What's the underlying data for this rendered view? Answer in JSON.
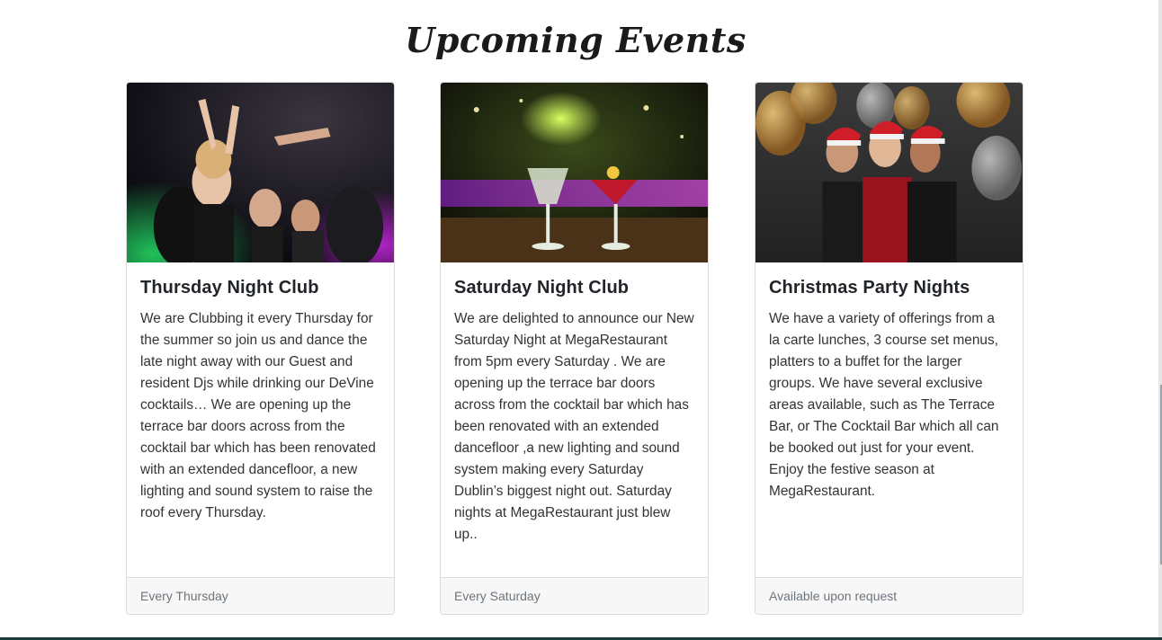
{
  "section": {
    "title": "Upcoming Events"
  },
  "events": [
    {
      "title": "Thursday Night Club",
      "description": "We are Clubbing it every Thursday for the summer so join us and dance the late night away with our Guest and resident Djs while drinking our DeVine cocktails… We are opening up the terrace bar doors across from the cocktail bar which has been renovated with an extended dancefloor, a new lighting and sound system to raise the roof every Thursday.",
      "footer": "Every Thursday",
      "image": "club-dancing-photo"
    },
    {
      "title": "Saturday Night Club",
      "description": "We are delighted to announce our New Saturday Night at MegaRestaurant from 5pm every Saturday . We are opening up the terrace bar doors across from the cocktail bar which has been renovated with an extended dancefloor ,a new lighting and sound system making every Saturday Dublin’s biggest night out. Saturday nights at MegaRestaurant just blew up..",
      "footer": "Every Saturday",
      "image": "cocktails-bar-photo"
    },
    {
      "title": "Christmas Party Nights",
      "description": "We have a variety of offerings from a la carte lunches, 3 course set menus, platters to a buffet for the larger groups. We have several exclusive areas available, such as The Terrace Bar, or The Cocktail Bar which all can be booked out just for your event. Enjoy the festive season at MegaRestaurant.",
      "footer": "Available upon request",
      "image": "christmas-party-photo"
    }
  ]
}
